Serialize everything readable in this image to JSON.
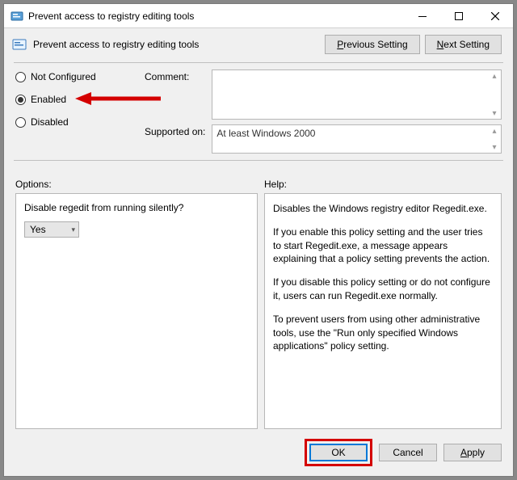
{
  "window": {
    "title": "Prevent access to registry editing tools"
  },
  "header": {
    "title": "Prevent access to registry editing tools",
    "previous": "Previous Setting",
    "next": "Next Setting"
  },
  "radios": {
    "not_configured": "Not Configured",
    "enabled": "Enabled",
    "disabled": "Disabled",
    "selected": "enabled"
  },
  "comment": {
    "label": "Comment:",
    "value": ""
  },
  "supported": {
    "label": "Supported on:",
    "value": "At least Windows 2000"
  },
  "options": {
    "section_label": "Options:",
    "prompt": "Disable regedit from running silently?",
    "value": "Yes"
  },
  "help": {
    "section_label": "Help:",
    "paragraphs": [
      "Disables the Windows registry editor Regedit.exe.",
      "If you enable this policy setting and the user tries to start Regedit.exe, a message appears explaining that a policy setting prevents the action.",
      "If you disable this policy setting or do not configure it, users can run Regedit.exe normally.",
      "To prevent users from using other administrative tools, use the \"Run only specified Windows applications\" policy setting."
    ]
  },
  "buttons": {
    "ok": "OK",
    "cancel": "Cancel",
    "apply": "Apply"
  }
}
